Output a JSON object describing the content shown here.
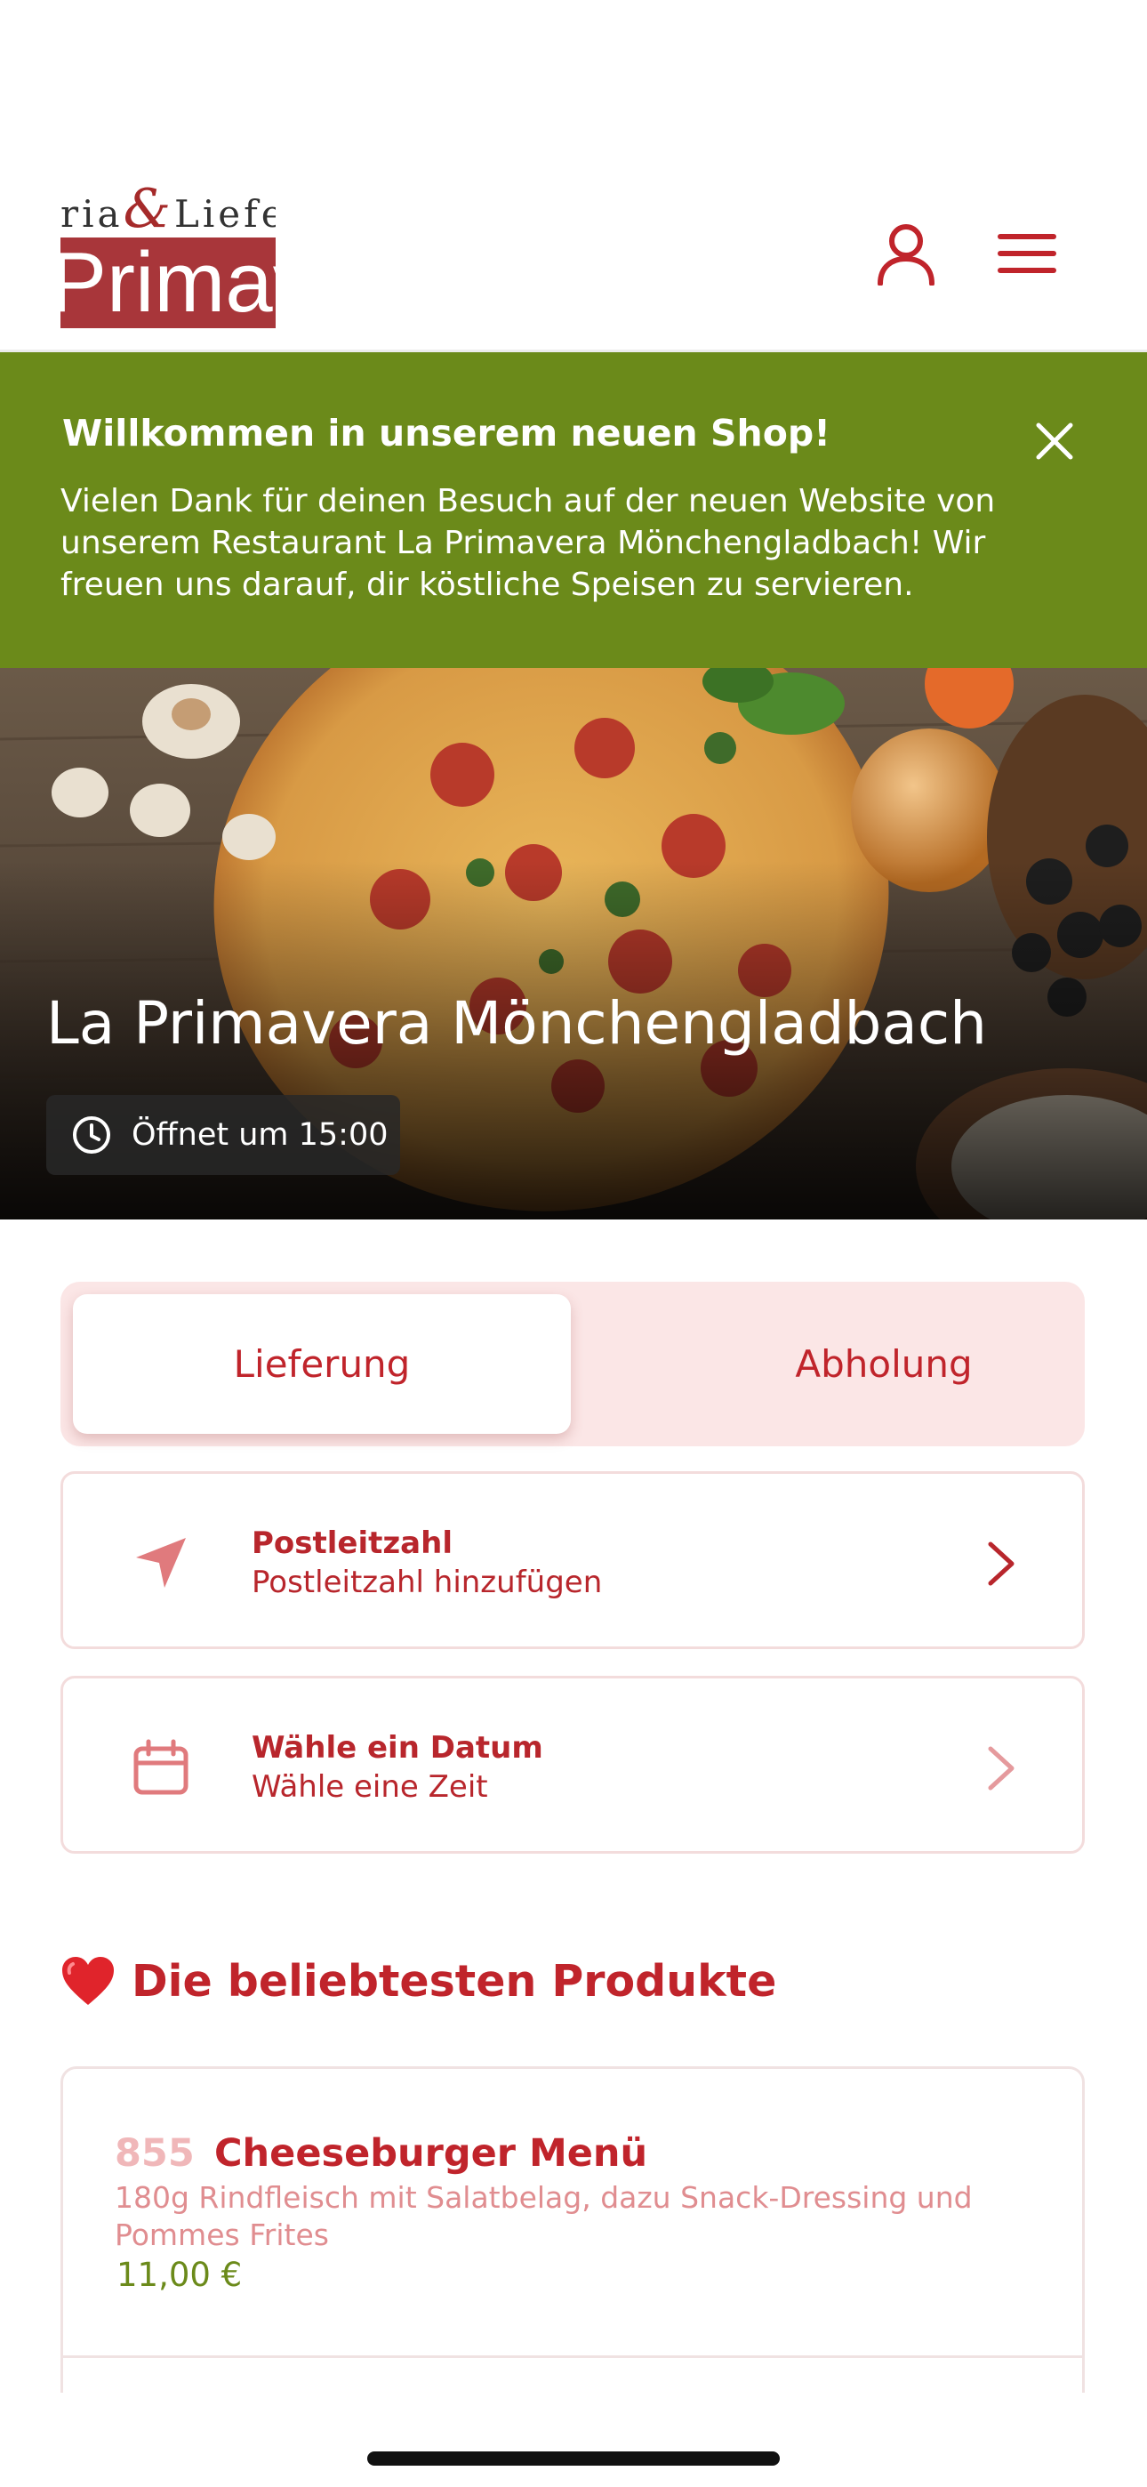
{
  "header": {
    "logo_top_text": "ria",
    "logo_amp": "&",
    "logo_top_text2": "Liefe",
    "logo_bar_text": "Primav",
    "user_icon": "user-icon",
    "menu_icon": "hamburger-menu-icon"
  },
  "banner": {
    "title": "Willkommen in unserem neuen Shop!",
    "text": "Vielen Dank für deinen Besuch auf der neuen Website von unserem Restaurant La Primavera Mönchengladbach! Wir freuen uns darauf, dir köstliche Speisen zu servieren.",
    "close_icon": "close-icon",
    "color": "#6b8a1a"
  },
  "hero": {
    "title": "La Primavera Mönchengladbach",
    "status": "Öffnet um 15:00",
    "status_icon": "clock-icon"
  },
  "mode_switch": {
    "tabs": [
      {
        "label": "Lieferung",
        "active": true
      },
      {
        "label": "Abholung",
        "active": false
      }
    ]
  },
  "options": [
    {
      "title": "Postleitzahl",
      "subtitle": "Postleitzahl hinzufügen",
      "icon": "location-arrow-icon"
    },
    {
      "title": "Wähle ein Datum",
      "subtitle": "Wähle eine Zeit",
      "icon": "calendar-icon"
    }
  ],
  "section": {
    "emoji": "❤️",
    "title": "Die beliebtesten Produkte"
  },
  "products": [
    {
      "number": "855",
      "name": "Cheeseburger Menü",
      "description": "180g Rindfleisch mit Salatbelag, dazu Snack-Dressing und Pommes Frites",
      "price": "11,00 €"
    }
  ],
  "colors": {
    "accent": "#c0242b",
    "price": "#6b8a1a",
    "tab_bg": "#fbe6e6"
  }
}
